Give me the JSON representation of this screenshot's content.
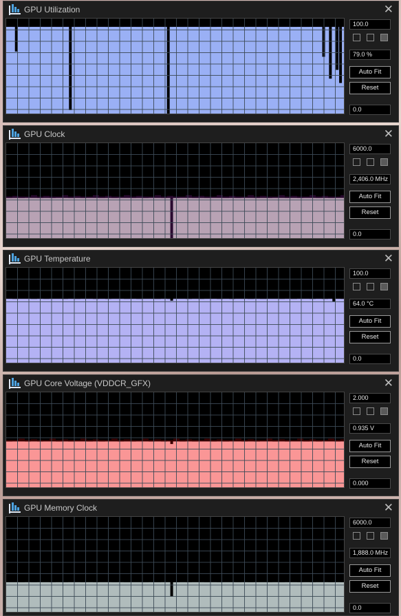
{
  "windows": [
    {
      "title": "GPU Utilization",
      "max": "100.0",
      "current": "79.0 %",
      "min": "0.0",
      "auto_fit": "Auto Fit",
      "reset": "Reset",
      "fill": "#9ab0f5",
      "level": 0.92,
      "line": "#000000",
      "dips": [
        [
          0.03,
          0.29
        ],
        [
          0.19,
          0.96
        ],
        [
          0.48,
          1.2
        ],
        [
          0.94,
          0.35
        ],
        [
          0.96,
          0.6
        ],
        [
          0.98,
          0.5
        ],
        [
          0.99,
          0.65
        ]
      ]
    },
    {
      "title": "GPU Clock",
      "max": "6000.0",
      "current": "2,406.0 MHz",
      "min": "0.0",
      "auto_fit": "Auto Fit",
      "reset": "Reset",
      "fill": "#b8a2b4",
      "level": 0.43,
      "line": "#2a0a30",
      "dips": [
        [
          0.49,
          1.1
        ]
      ]
    },
    {
      "title": "GPU Temperature",
      "max": "100.0",
      "current": "64.0 °C",
      "min": "0.0",
      "auto_fit": "Auto Fit",
      "reset": "Reset",
      "fill": "#b4b2f4",
      "level": 0.68,
      "line": "#000000",
      "dips": [
        [
          0.49,
          0.04
        ],
        [
          0.97,
          0.05
        ]
      ]
    },
    {
      "title": "GPU Core Voltage (VDDCR_GFX)",
      "max": "2.000",
      "current": "0.935 V",
      "min": "0.000",
      "auto_fit": "Auto Fit",
      "reset": "Reset",
      "fill": "#fa9696",
      "level": 0.49,
      "line": "#3a0000",
      "dips": [
        [
          0.49,
          0.07
        ]
      ]
    },
    {
      "title": "GPU Memory Clock",
      "max": "6000.0",
      "current": "1,888.0 MHz",
      "min": "0.0",
      "auto_fit": "Auto Fit",
      "reset": "Reset",
      "fill": "#b0bcbc",
      "level": 0.32,
      "line": "#000000",
      "dips": [
        [
          0.49,
          0.5
        ]
      ]
    }
  ]
}
